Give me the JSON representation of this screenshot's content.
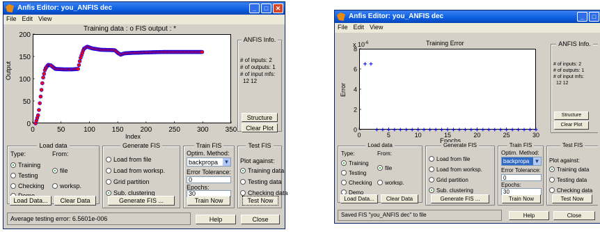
{
  "window_left": {
    "title": "Anfis Editor: you_ANFIS dec",
    "menu": [
      "File",
      "Edit",
      "View"
    ],
    "plot": {
      "title": "Training data : o   FIS output : *",
      "xlabel": "Index",
      "ylabel": "Output",
      "xticks": [
        "0",
        "50",
        "100",
        "150",
        "200",
        "250",
        "300",
        "350"
      ],
      "yticks": [
        "0",
        "50",
        "100",
        "150",
        "200"
      ]
    },
    "info": {
      "title": "ANFIS Info.",
      "lines": [
        "# of inputs: 2",
        "# of outputs: 1",
        "# of input mfs:",
        "12 12"
      ],
      "structure_button": "Structure",
      "clear_plot_button": "Clear Plot"
    },
    "load": {
      "title": "Load data",
      "type_label": "Type:",
      "from_label": "From:",
      "types": [
        "Training",
        "Testing",
        "Checking",
        "Demo"
      ],
      "froms": [
        "file",
        "worksp."
      ],
      "load_button": "Load Data...",
      "clear_button": "Clear Data"
    },
    "generate": {
      "title": "Generate FIS",
      "options": [
        "Load from file",
        "Load from worksp.",
        "Grid partition",
        "Sub. clustering"
      ],
      "button": "Generate FIS ..."
    },
    "train": {
      "title": "Train FIS",
      "method_label": "Optim. Method:",
      "method_value": "backpropa",
      "tolerance_label": "Error Tolerance:",
      "tolerance_value": "0",
      "epochs_label": "Epochs:",
      "epochs_value": "30",
      "button": "Train Now"
    },
    "test": {
      "title": "Test FIS",
      "plot_against": "Plot against:",
      "options": [
        "Training data",
        "Testing data",
        "Checking data"
      ],
      "button": "Test Now"
    },
    "status": "Average testing error: 6.5601e-006",
    "help_button": "Help",
    "close_button": "Close"
  },
  "window_right": {
    "title": "Anfis Editor: you_ANFIS dec",
    "menu": [
      "File",
      "Edit",
      "View"
    ],
    "plot": {
      "title": "Training Error",
      "xlabel": "Epochs",
      "ylabel": "Error",
      "exponent": "x 10",
      "exponent_power": "-6",
      "xticks": [
        "0",
        "5",
        "10",
        "15",
        "20",
        "25",
        "30"
      ],
      "yticks": [
        "0",
        "2",
        "4",
        "6",
        "8"
      ]
    },
    "info": {
      "title": "ANFIS Info.",
      "lines": [
        "# of inputs: 2",
        "# of outputs: 1",
        "# of input mfs:",
        "12 12"
      ],
      "structure_button": "Structure",
      "clear_plot_button": "Clear Plot"
    },
    "load": {
      "title": "Load data",
      "type_label": "Type:",
      "from_label": "From:",
      "types": [
        "Training",
        "Testing",
        "Checking",
        "Demo"
      ],
      "froms": [
        "file",
        "worksp."
      ],
      "load_button": "Load Data...",
      "clear_button": "Clear Data"
    },
    "generate": {
      "title": "Generate FIS",
      "options": [
        "Load from file",
        "Load from worksp.",
        "Grid partition",
        "Sub. clustering"
      ],
      "button": "Generate FIS ..."
    },
    "train": {
      "title": "Train FIS",
      "method_label": "Optim. Method:",
      "method_value": "backpropa",
      "tolerance_label": "Error Tolerance:",
      "tolerance_value": "0",
      "epochs_label": "Epochs:",
      "epochs_value": "30",
      "button": "Train Now"
    },
    "test": {
      "title": "Test FIS",
      "plot_against": "Plot against:",
      "options": [
        "Training data",
        "Testing data",
        "Checking data"
      ],
      "button": "Test Now"
    },
    "status": "Saved FIS \"you_ANFIS dec\" to file",
    "help_button": "Help",
    "close_button": "Close"
  },
  "chart_data": [
    {
      "type": "scatter",
      "title": "Training data : o   FIS output : *",
      "xlabel": "Index",
      "ylabel": "Output",
      "xlim": [
        0,
        350
      ],
      "ylim": [
        0,
        200
      ],
      "series": [
        {
          "name": "Training data",
          "marker": "o",
          "color": "#0000ff"
        },
        {
          "name": "FIS output",
          "marker": "*",
          "color": "#ff0000"
        }
      ],
      "curve_points": [
        [
          5,
          0
        ],
        [
          10,
          20
        ],
        [
          14,
          60
        ],
        [
          18,
          100
        ],
        [
          22,
          122
        ],
        [
          27,
          131
        ],
        [
          32,
          130
        ],
        [
          40,
          122
        ],
        [
          55,
          121
        ],
        [
          70,
          121
        ],
        [
          80,
          122
        ],
        [
          84,
          145
        ],
        [
          90,
          167
        ],
        [
          96,
          172
        ],
        [
          105,
          168
        ],
        [
          120,
          165
        ],
        [
          145,
          164
        ],
        [
          150,
          158
        ],
        [
          155,
          154
        ],
        [
          162,
          157
        ],
        [
          175,
          158
        ],
        [
          200,
          159
        ],
        [
          230,
          160
        ],
        [
          260,
          160
        ],
        [
          300,
          160
        ]
      ]
    },
    {
      "type": "scatter",
      "title": "Training Error",
      "xlabel": "Epochs",
      "ylabel": "Error",
      "xlim": [
        0,
        30
      ],
      "ylim": [
        0,
        8
      ],
      "y_multiplier": "x 10^-6",
      "series": [
        {
          "name": "Error",
          "marker": "+",
          "color": "#0000ff",
          "x": [
            1,
            2,
            3,
            4,
            5,
            6,
            7,
            8,
            9,
            10,
            11,
            12,
            13,
            14,
            15,
            16,
            17,
            18,
            19,
            20,
            21,
            22,
            23,
            24,
            25,
            26,
            27,
            28,
            29,
            30
          ],
          "y": [
            6.5,
            6.5,
            0,
            0,
            0,
            0,
            0,
            0,
            0,
            0,
            0,
            0,
            0,
            0,
            0,
            0,
            0,
            0,
            0,
            0,
            0,
            0,
            0,
            0,
            0,
            0,
            0,
            0,
            0,
            0
          ]
        }
      ]
    }
  ]
}
